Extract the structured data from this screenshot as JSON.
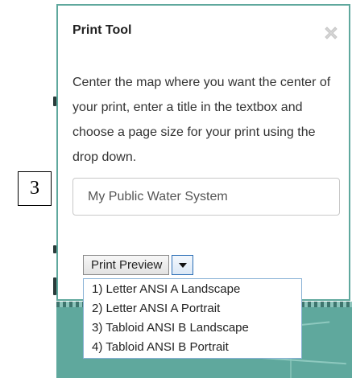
{
  "panel": {
    "title": "Print Tool",
    "description": "Center the map where you want the center of your print, enter a title in the textbox and choose a page size for your print using the drop down.",
    "title_input": {
      "value": "",
      "placeholder": "My Public Water System"
    },
    "close_icon": "close-icon"
  },
  "step_label": "3",
  "print_button": {
    "label": "Print Preview",
    "arrow_icon": "caret-down-icon"
  },
  "page_size_menu": {
    "items": [
      "1) Letter ANSI A Landscape",
      "2) Letter ANSI A Portrait",
      "3) Tabloid ANSI B Landscape",
      "4) Tabloid ANSI B Portrait"
    ]
  },
  "colors": {
    "panel_border": "#5fa89d",
    "map_teal": "#5fa89d",
    "menu_border": "#8ab2d6",
    "dropdown_arrow_border": "#2c6fb6"
  }
}
